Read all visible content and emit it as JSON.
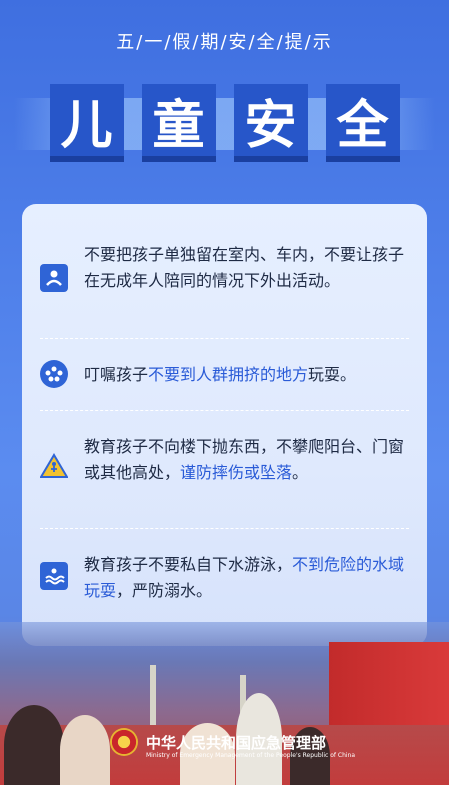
{
  "header": {
    "subtitle": "五/一/假/期/安/全/提/示",
    "title_chars": [
      "儿",
      "童",
      "安",
      "全"
    ]
  },
  "items": [
    {
      "icon": "child-protect-icon",
      "segments": [
        {
          "text": "不要把孩子单独留在室内、车内，不要让孩子在无成年人陪同的情况下外出活动。",
          "highlight": false
        }
      ]
    },
    {
      "icon": "crowd-icon",
      "segments": [
        {
          "text": "叮嘱孩子",
          "highlight": false
        },
        {
          "text": "不要到人群拥挤的地方",
          "highlight": true
        },
        {
          "text": "玩耍。",
          "highlight": false
        }
      ]
    },
    {
      "icon": "fall-warning-icon",
      "segments": [
        {
          "text": "教育孩子不向楼下抛东西，不攀爬阳台、门窗或其他高处，",
          "highlight": false
        },
        {
          "text": "谨防摔伤或坠落",
          "highlight": true
        },
        {
          "text": "。",
          "highlight": false
        }
      ]
    },
    {
      "icon": "drowning-icon",
      "segments": [
        {
          "text": "教育孩子不要私自下水游泳，",
          "highlight": false
        },
        {
          "text": "不到危险的水域玩耍",
          "highlight": true
        },
        {
          "text": "，严防溺水。",
          "highlight": false
        }
      ]
    }
  ],
  "footer": {
    "org_cn": "中华人民共和国应急管理部",
    "org_en": "Ministry of Emergency Management of the People's Republic of China"
  },
  "colors": {
    "background": "#4f80ea",
    "card": "#e2ecff",
    "highlight": "#2a5bd7",
    "title_block": "#2756c9"
  }
}
